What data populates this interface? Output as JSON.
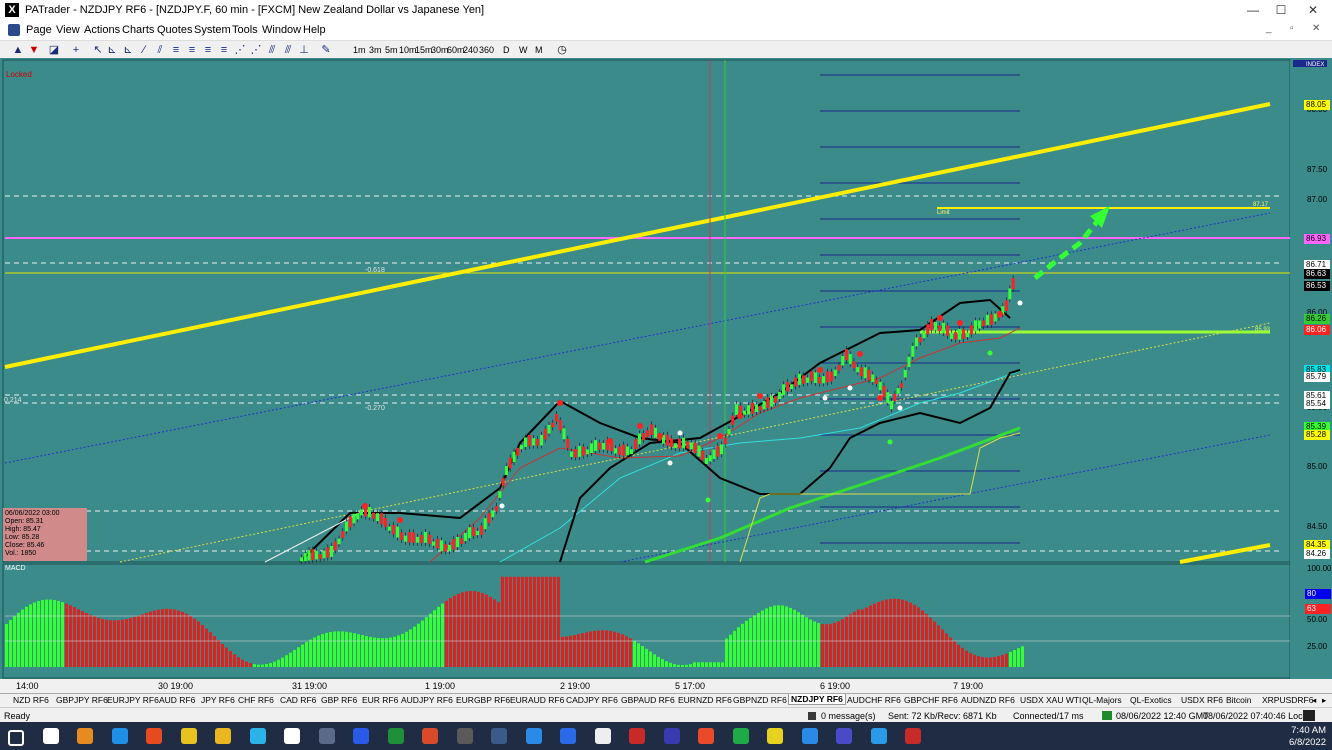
{
  "window": {
    "app_icon": "X",
    "title": "PATrader - NZDJPY RF6 - [NZDJPY.F, 60 min - [FXCM] New Zealand Dollar vs Japanese Yen]"
  },
  "menu": [
    "Page",
    "View",
    "Actions",
    "Charts",
    "Quotes",
    "System",
    "Tools",
    "Window",
    "Help"
  ],
  "timeframes": [
    "1m",
    "3m",
    "5m",
    "10m",
    "15m",
    "30m",
    "60m",
    "240",
    "360",
    "D",
    "W",
    "M"
  ],
  "chart": {
    "locked_label": "Locked",
    "index_label": "INDEX",
    "fib_labels": {
      "f1": "-0.618",
      "f2": "-0.270",
      "f3": "0.214"
    },
    "limit_label": "Limit",
    "limit_price": "87.17",
    "small_label": "85.93",
    "price_axis": [
      "88.00",
      "87.50",
      "87.00",
      "86.50",
      "86.00",
      "85.50",
      "85.00",
      "84.50"
    ],
    "price_labels": [
      {
        "text": "88.05",
        "bg": "#ffff00",
        "fg": "#000000"
      },
      {
        "text": "86.93",
        "bg": "#ff66ff",
        "fg": "#000000"
      },
      {
        "text": "86.71",
        "bg": "#ffffff",
        "fg": "#000000"
      },
      {
        "text": "86.63",
        "bg": "#000000",
        "fg": "#ffffff"
      },
      {
        "text": "86.53",
        "bg": "#000000",
        "fg": "#ffffff"
      },
      {
        "text": "86.26",
        "bg": "#33cc33",
        "fg": "#000000"
      },
      {
        "text": "86.06",
        "bg": "#ff2222",
        "fg": "#ffffff"
      },
      {
        "text": "85.83",
        "bg": "#00e5ee",
        "fg": "#000000"
      },
      {
        "text": "85.79",
        "bg": "#ffffff",
        "fg": "#000000"
      },
      {
        "text": "85.61",
        "bg": "#ffffff",
        "fg": "#000000"
      },
      {
        "text": "85.54",
        "bg": "#ffffff",
        "fg": "#000000"
      },
      {
        "text": "85.39",
        "bg": "#33ff33",
        "fg": "#000000"
      },
      {
        "text": "85.28",
        "bg": "#ffff00",
        "fg": "#000000"
      },
      {
        "text": "84.35",
        "bg": "#ffff00",
        "fg": "#000000"
      },
      {
        "text": "84.26",
        "bg": "#ffffff",
        "fg": "#000000"
      }
    ],
    "bar_info": {
      "date": "06/06/2022 03:00",
      "open": "Open: 85.31",
      "high": "High: 85.47",
      "low": "Low: 85.28",
      "close": "Close: 85.46",
      "vol": "Vol.: 1850"
    },
    "indicator_label": "MACD",
    "indicator_axis": [
      "100.00",
      "75.00",
      "50.00",
      "25.00"
    ],
    "indicator_labels": [
      {
        "text": "80",
        "bg": "#0000ee",
        "fg": "#ffffff"
      },
      {
        "text": "63",
        "bg": "#ff2222",
        "fg": "#ffffff"
      }
    ],
    "time_axis": [
      "14:00",
      "30 19:00",
      "31 19:00",
      "1 19:00",
      "2 19:00",
      "5 17:00",
      "6 19:00",
      "7 19:00"
    ]
  },
  "symbol_tabs": [
    "NZD RF6",
    "GBPJPY RF6",
    "EURJPY RF6",
    "AUD RF6",
    "JPY RF6",
    "CHF RF6",
    "CAD RF6",
    "GBP RF6",
    "EUR RF6",
    "AUDJPY RF6",
    "EURGBP RF6",
    "EURAUD RF6",
    "CADJPY RF6",
    "GBPAUD RF6",
    "EURNZD RF6",
    "GBPNZD RF6",
    "NZDJPY RF6",
    "AUDCHF RF6",
    "GBPCHF RF6",
    "AUDNZD RF6",
    "USDX XAU WTI",
    "QL-Majors",
    "QL-Exotics",
    "USDX RF6",
    "Bitcoin",
    "XRPUSDRF6"
  ],
  "active_symbol": "NZDJPY RF6",
  "status": {
    "ready": "Ready",
    "messages": "0 message(s)",
    "traffic": "Sent: 72 Kb/Recv: 6871 Kb",
    "connection": "Connected/17 ms",
    "gmt": "08/06/2022 12:40 GMT",
    "local": "08/06/2022 07:40:46 Local"
  },
  "clock": {
    "time": "7:40 AM",
    "date": "6/8/2022"
  },
  "taskbar_icons": [
    "windows-start-icon",
    "search-icon",
    "outlook-icon",
    "edge-icon",
    "brave-icon",
    "chrome-icon",
    "file-explorer-icon",
    "notepad-icon",
    "patrader-icon",
    "calculator-icon",
    "word-icon",
    "excel-icon",
    "powerpoint-icon",
    "app-icon",
    "app-icon",
    "skype-icon",
    "app-icon",
    "tradingview-icon",
    "app-icon",
    "app-icon",
    "app-icon",
    "app-icon",
    "sticky-notes-icon",
    "app-icon",
    "app-icon",
    "telegram-icon",
    "app-icon"
  ]
}
